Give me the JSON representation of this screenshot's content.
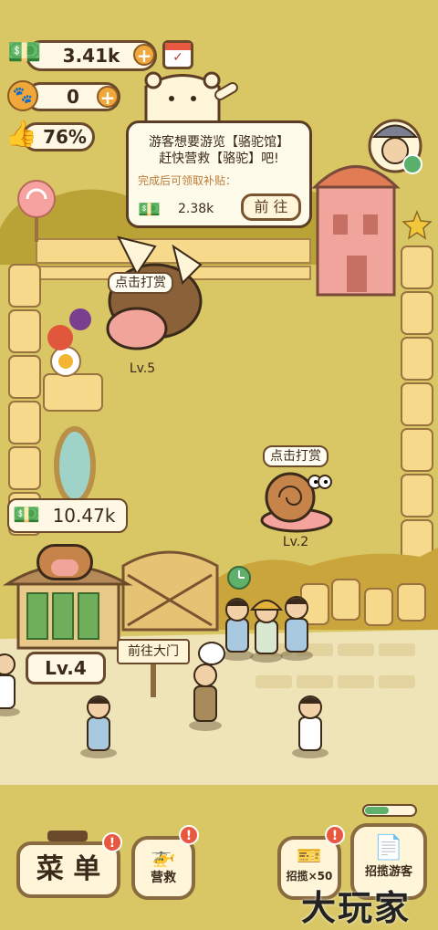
{
  "hud": {
    "money": "3.41k",
    "paw_count": "0",
    "rating": "76%"
  },
  "quest": {
    "line1": "游客想要游览【骆驼馆】",
    "line2": "赶快营救【骆驼】吧!",
    "reward_label": "完成后可领取补贴：",
    "reward_value": "2.38k",
    "go_button": "前 往"
  },
  "scene": {
    "tip_hedgehog": "点击打赏",
    "tip_snail": "点击打赏",
    "hedgehog_level": "Lv.5",
    "snail_level": "Lv.2",
    "shop_income": "10.47k",
    "shop_level": "Lv.4",
    "gate_sign": "前往大门"
  },
  "bottom": {
    "menu_label": "菜 单",
    "rescue_label": "营救",
    "recruit_count_label": "招揽×50",
    "recruit_visitors_label": "招揽游客",
    "watermark": "大玩家"
  },
  "colors": {
    "ground": "#d9c765",
    "path": "#efe3b8",
    "fence": "#f3d37a",
    "border_brown": "#6b4a2b",
    "badge_red": "#e8573f"
  }
}
